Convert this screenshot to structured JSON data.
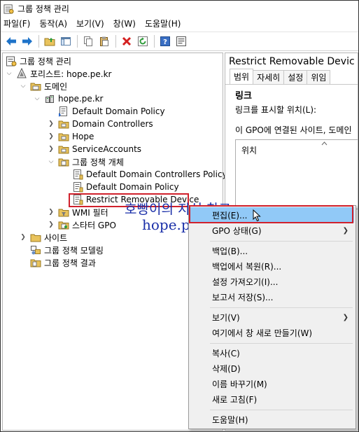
{
  "window": {
    "title": "그룹 정책 관리"
  },
  "menu": [
    "파일(F)",
    "동작(A)",
    "보기(V)",
    "창(W)",
    "도움말(H)"
  ],
  "toolbar": [
    "back-icon",
    "forward-icon",
    "up-folder-icon",
    "show-hide-tree-icon",
    "copy-icon",
    "paste-icon",
    "delete-icon",
    "refresh-icon",
    "help-icon",
    "properties-icon"
  ],
  "tree": {
    "root": "그룹 정책 관리",
    "forest": "포리스트: hope.pe.kr",
    "domains": "도메인",
    "domain": "hope.pe.kr",
    "items": [
      "Default Domain Policy",
      "Domain Controllers",
      "Hope",
      "ServiceAccounts"
    ],
    "gpo_container": "그룹 정책 개체",
    "gpos": [
      "Default Domain Controllers Policy",
      "Default Domain Policy",
      "Restrict Removable Device"
    ],
    "wmi": "WMI 필터",
    "starter": "스타터 GPO",
    "sites": "사이트",
    "modeling": "그룹 정책 모델링",
    "results": "그룹 정책 결과"
  },
  "right": {
    "title": "Restrict Removable Devic",
    "tabs": [
      "범위",
      "자세히",
      "설정",
      "위임"
    ],
    "section": "링크",
    "display_label": "링크를 표시할 위치(L):",
    "linked_text": "이 GPO에 연결된 사이트, 도메인",
    "column": "위치"
  },
  "context_menu": {
    "items": [
      "편집(E)...",
      "GPO 상태(G)",
      "백업(B)...",
      "백업에서 복원(R)...",
      "설정 가져오기(I)...",
      "보고서 저장(S)...",
      "보기(V)",
      "여기에서 창 새로 만들기(W)",
      "복사(C)",
      "삭제(D)",
      "이름 바꾸기(M)",
      "새로 고침(F)",
      "도움말(H)"
    ]
  },
  "watermark": {
    "line1": "호빵이의 지식 창고",
    "line2": "hope.pe.kr"
  },
  "colors": {
    "highlight": "#d0212c",
    "hover": "#91c9f7",
    "watermark": "#1a2fa8"
  }
}
